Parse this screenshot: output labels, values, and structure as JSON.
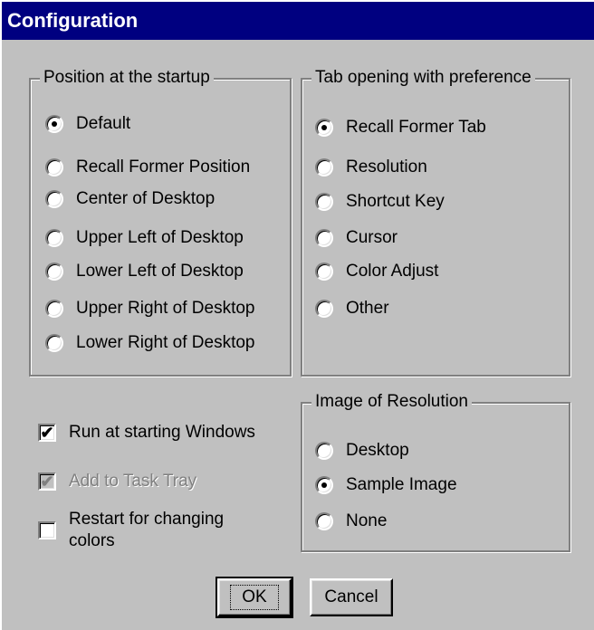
{
  "window": {
    "title": "Configuration"
  },
  "position_group": {
    "title": "Position at the startup",
    "options": [
      {
        "label": "Default",
        "selected": true
      },
      {
        "label": "Recall Former Position",
        "selected": false
      },
      {
        "label": "Center of Desktop",
        "selected": false
      },
      {
        "label": "Upper Left of Desktop",
        "selected": false
      },
      {
        "label": "Lower Left of Desktop",
        "selected": false
      },
      {
        "label": "Upper Right of Desktop",
        "selected": false
      },
      {
        "label": "Lower Right of Desktop",
        "selected": false
      }
    ]
  },
  "tab_group": {
    "title": "Tab opening with preference",
    "options": [
      {
        "label": "Recall Former Tab",
        "selected": true
      },
      {
        "label": "Resolution",
        "selected": false
      },
      {
        "label": "Shortcut Key",
        "selected": false
      },
      {
        "label": "Cursor",
        "selected": false
      },
      {
        "label": "Color Adjust",
        "selected": false
      },
      {
        "label": "Other",
        "selected": false
      }
    ]
  },
  "image_group": {
    "title": "Image of Resolution",
    "options": [
      {
        "label": "Desktop",
        "selected": false
      },
      {
        "label": "Sample Image",
        "selected": true
      },
      {
        "label": "None",
        "selected": false
      }
    ]
  },
  "checkboxes": [
    {
      "label": "Run at starting Windows",
      "checked": true,
      "enabled": true
    },
    {
      "label": "Add to Task Tray",
      "checked": true,
      "enabled": false
    },
    {
      "label_line1": "Restart for changing",
      "label_line2": "colors",
      "checked": false,
      "enabled": true
    }
  ],
  "buttons": {
    "ok": "OK",
    "cancel": "Cancel"
  },
  "colors": {
    "titlebar": "#000080",
    "face": "#c0c0c0"
  }
}
